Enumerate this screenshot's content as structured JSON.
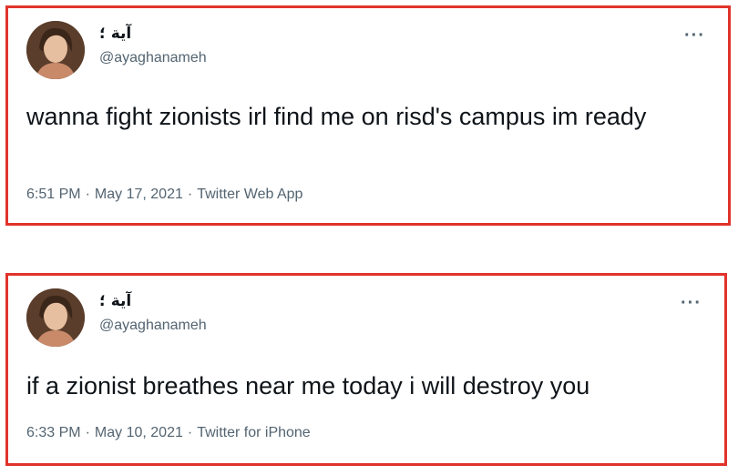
{
  "tweets": [
    {
      "display_name": "آية ؛",
      "handle": "@ayaghanameh",
      "text": "wanna fight zionists irl find me on risd's campus im ready",
      "time": "6:51 PM",
      "date": "May 17, 2021",
      "source": "Twitter Web App",
      "more_icon": "more-horizontal-icon"
    },
    {
      "display_name": "آية ؛",
      "handle": "@ayaghanameh",
      "text": "if a zionist breathes near me today i will destroy you",
      "time": "6:33 PM",
      "date": "May 10, 2021",
      "source": "Twitter for iPhone",
      "more_icon": "more-horizontal-icon"
    }
  ],
  "separator": "·",
  "more_glyph": "···",
  "colors": {
    "highlight_border": "#e0332b",
    "text_primary": "#0f1419",
    "text_secondary": "#536471"
  }
}
